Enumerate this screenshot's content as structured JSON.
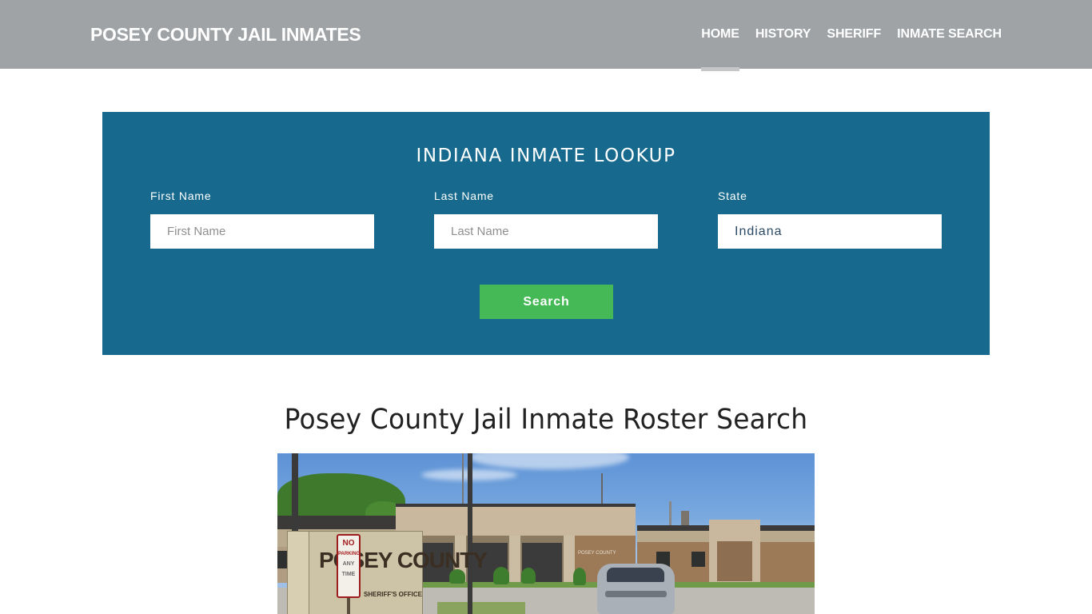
{
  "header": {
    "brand": "POSEY COUNTY JAIL INMATES",
    "nav": [
      {
        "label": "HOME",
        "active": true
      },
      {
        "label": "HISTORY",
        "active": false
      },
      {
        "label": "SHERIFF",
        "active": false
      },
      {
        "label": "INMATE SEARCH",
        "active": false
      }
    ]
  },
  "lookup": {
    "title": "INDIANA INMATE LOOKUP",
    "fields": [
      {
        "label": "First Name",
        "placeholder": "First Name",
        "value": ""
      },
      {
        "label": "Last Name",
        "placeholder": "Last Name",
        "value": ""
      },
      {
        "label": "State",
        "placeholder": "",
        "value": "Indiana"
      }
    ],
    "search_label": "Search"
  },
  "main": {
    "title": "Posey County Jail Inmate Roster Search",
    "photo": {
      "description": "Posey County Sheriff's Office building exterior",
      "sign_text": "POSEY COUNTY",
      "sign_subtext": "SHERIFF'S OFFICE",
      "no_parking_text": [
        "NO",
        "PARKING",
        "ANY",
        "TIME"
      ],
      "building_plaque": "POSEY COUNTY"
    }
  },
  "colors": {
    "header_bg": "#9fa3a6",
    "panel_bg": "#176a8d",
    "button_bg": "#44b955",
    "active_underline": "#c4c6c8"
  }
}
